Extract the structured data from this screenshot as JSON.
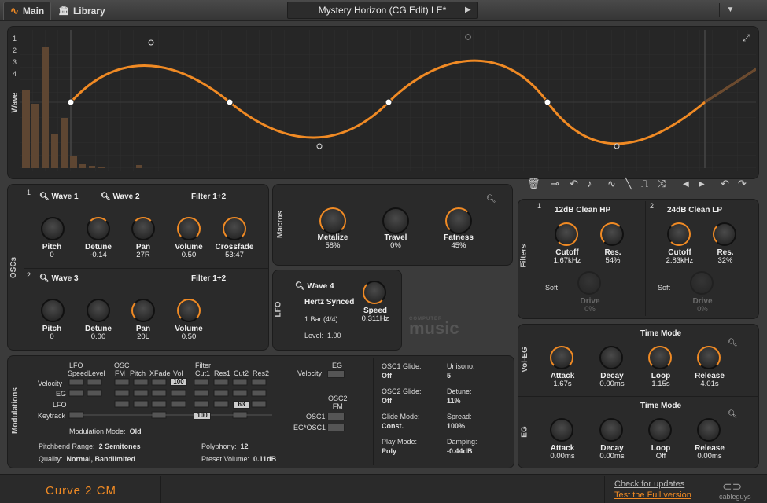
{
  "tabs": {
    "main": "Main",
    "library": "Library"
  },
  "preset": {
    "name": "Mystery Horizon (CG Edit) LE*"
  },
  "wave": {
    "axis_label": "Wave",
    "row_numbers": [
      "1",
      "2",
      "3",
      "4"
    ]
  },
  "oscs": {
    "section_label": "OSCs",
    "osc1": {
      "number": "1",
      "wave1": "Wave 1",
      "wave2": "Wave 2",
      "filter": "Filter 1+2",
      "knobs": [
        {
          "label": "Pitch",
          "value": "0"
        },
        {
          "label": "Detune",
          "value": "-0.14"
        },
        {
          "label": "Pan",
          "value": "27R"
        },
        {
          "label": "Volume",
          "value": "0.50"
        },
        {
          "label": "Crossfade",
          "value": "53:47"
        }
      ]
    },
    "osc2": {
      "number": "2",
      "wave": "Wave 3",
      "filter": "Filter 1+2",
      "knobs": [
        {
          "label": "Pitch",
          "value": "0"
        },
        {
          "label": "Detune",
          "value": "0.00"
        },
        {
          "label": "Pan",
          "value": "20L"
        },
        {
          "label": "Volume",
          "value": "0.50"
        }
      ]
    }
  },
  "macros": {
    "section_label": "Macros",
    "knobs": [
      {
        "label": "Metalize",
        "value": "58%"
      },
      {
        "label": "Travel",
        "value": "0%"
      },
      {
        "label": "Fatness",
        "value": "45%"
      }
    ]
  },
  "lfo": {
    "section_label": "LFO",
    "wave": "Wave 4",
    "sync": "Hertz Synced",
    "bar": "1 Bar (4/4)",
    "level_label": "Level:",
    "level": "1.00",
    "speed_label": "Speed",
    "speed": "0.311Hz"
  },
  "logo": {
    "top": "COMPUTER",
    "bottom": "music"
  },
  "filters": {
    "section_label": "Filters",
    "f1": {
      "number": "1",
      "type": "12dB Clean HP",
      "cutoff_label": "Cutoff",
      "cutoff": "1.67kHz",
      "res_label": "Res.",
      "res": "54%",
      "soft": "Soft",
      "drive_label": "Drive",
      "drive": "0%"
    },
    "f2": {
      "number": "2",
      "type": "24dB Clean LP",
      "cutoff_label": "Cutoff",
      "cutoff": "2.83kHz",
      "res_label": "Res.",
      "res": "32%",
      "soft": "Soft",
      "drive_label": "Drive",
      "drive": "0%"
    }
  },
  "voleg": {
    "section_label": "Vol-EG",
    "mode": "Time Mode",
    "knobs": [
      {
        "label": "Attack",
        "value": "1.67s"
      },
      {
        "label": "Decay",
        "value": "0.00ms"
      },
      {
        "label": "Loop",
        "value": "1.15s"
      },
      {
        "label": "Release",
        "value": "4.01s"
      }
    ]
  },
  "eg": {
    "section_label": "EG",
    "mode": "Time Mode",
    "knobs": [
      {
        "label": "Attack",
        "value": "0.00ms"
      },
      {
        "label": "Decay",
        "value": "0.00ms"
      },
      {
        "label": "Loop",
        "value": "Off"
      },
      {
        "label": "Release",
        "value": "0.00ms"
      }
    ]
  },
  "mods": {
    "section_label": "Modulations",
    "lfo_group": "LFO",
    "osc_group": "OSC",
    "filter_group": "Filter",
    "cols": [
      "Speed",
      "Level",
      "FM",
      "Pitch",
      "XFade",
      "Vol",
      "Cut1",
      "Res1",
      "Cut2",
      "Res2"
    ],
    "rows": [
      "Velocity",
      "EG",
      "LFO",
      "Keytrack"
    ],
    "cell_vol_velocity": "100",
    "cell_cut2_lfo": "63",
    "cell_keytrack": "100",
    "eg_col": "EG",
    "velocity_row": "Velocity",
    "osc2fm_col": "OSC2\nFM",
    "osc1_row": "OSC1",
    "egosc1_row": "EG*OSC1",
    "mod_mode_label": "Modulation Mode:",
    "mod_mode": "Old",
    "pitchbend_label": "Pitchbend Range:",
    "pitchbend": "2 Semitones",
    "polyphony_label": "Polyphony:",
    "polyphony": "12",
    "quality_label": "Quality:",
    "quality": "Normal, Bandlimited",
    "presetvol_label": "Preset Volume:",
    "presetvol": "0.11dB",
    "osc1glide_label": "OSC1 Glide:",
    "osc1glide": "Off",
    "osc2glide_label": "OSC2 Glide:",
    "osc2glide": "Off",
    "glidemode_label": "Glide Mode:",
    "glidemode": "Const.",
    "playmode_label": "Play Mode:",
    "playmode": "Poly",
    "unisono_label": "Unisono:",
    "unisono": "5",
    "detune_label": "Detune:",
    "detune": "11%",
    "spread_label": "Spread:",
    "spread": "100%",
    "damping_label": "Damping:",
    "damping": "-0.44dB"
  },
  "footer": {
    "product": "Curve 2 CM",
    "check": "Check for updates",
    "full": "Test the Full version",
    "brand": "cableguys"
  },
  "colors": {
    "accent": "#f08a24",
    "panel": "#2a2a2a",
    "background": "#3b3b3b"
  }
}
